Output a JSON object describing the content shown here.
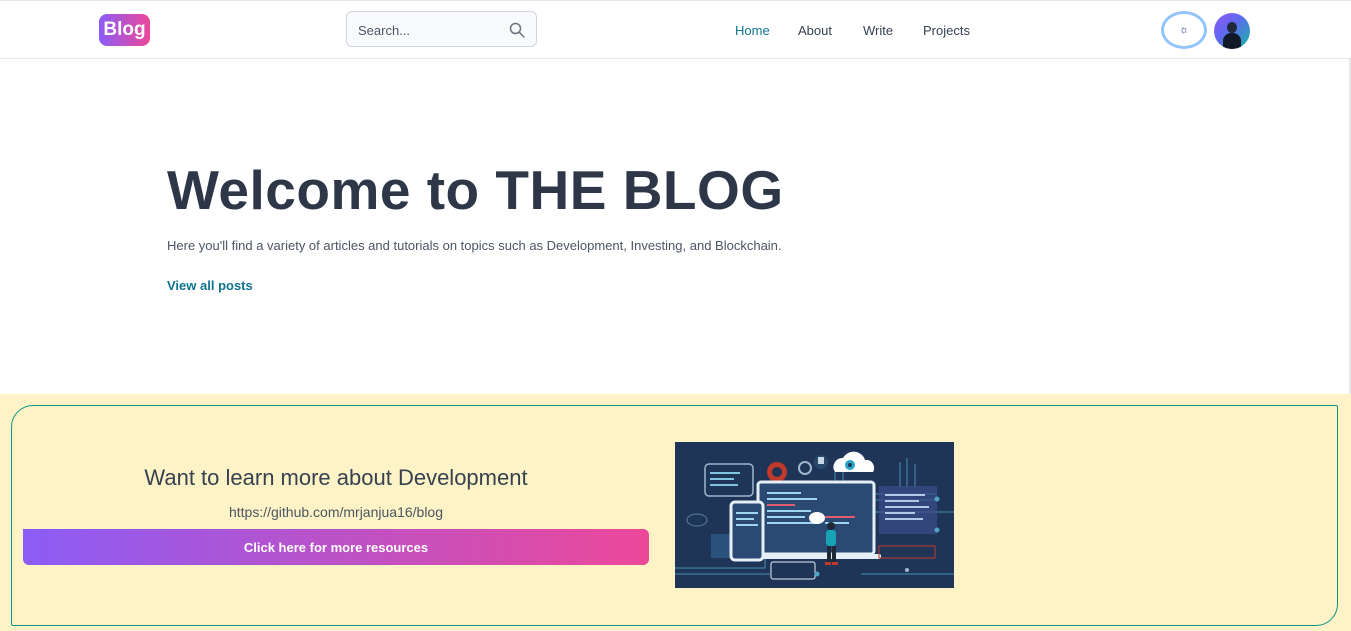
{
  "header": {
    "logo": "Blog",
    "search": {
      "placeholder": "Search...",
      "value": ""
    },
    "nav": [
      {
        "label": "Home",
        "active": true
      },
      {
        "label": "About",
        "active": false
      },
      {
        "label": "Write",
        "active": false
      },
      {
        "label": "Projects",
        "active": false
      }
    ],
    "theme_toggle_icon": "sun-icon"
  },
  "hero": {
    "title": "Welcome to THE BLOG",
    "subtitle": "Here you'll find a variety of articles and tutorials on topics such as Development, Investing, and Blockchain.",
    "link": "View all posts"
  },
  "banner": {
    "heading": "Want to learn more about Development",
    "url": "https://github.com/mrjanjua16/blog",
    "button": "Click here for more resources"
  },
  "colors": {
    "accent": "#0e7490",
    "gradient_start": "#8b5cf6",
    "gradient_end": "#ec4899",
    "banner_background": "#fef3c7"
  }
}
